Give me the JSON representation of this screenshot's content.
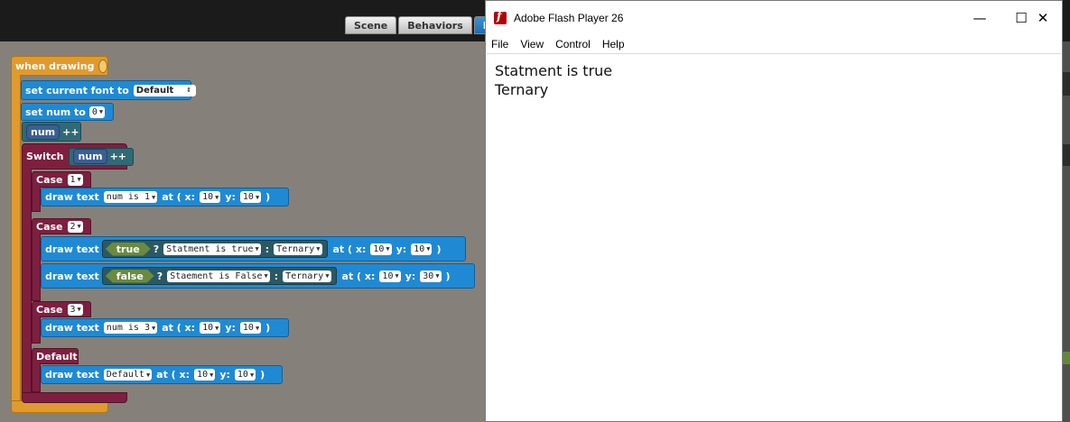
{
  "tabs": [
    "Scene",
    "Behaviors",
    "E"
  ],
  "blocks": {
    "event": "when drawing",
    "set_font": {
      "label": "set current font to",
      "value": "Default"
    },
    "set_num": {
      "label": "set num to",
      "value": "0"
    },
    "num_inc": {
      "var": "num",
      "op": "++"
    },
    "switch": {
      "label": "Switch",
      "var": "num",
      "op": "++"
    },
    "case1": {
      "label": "Case",
      "value": "1",
      "draw": {
        "label": "draw text",
        "text": "num is 1",
        "at": "at ( x:",
        "x": "10",
        "y_label": "y:",
        "y": "10",
        "close": ")"
      }
    },
    "case2": {
      "label": "Case",
      "value": "2",
      "draw1": {
        "label": "draw text",
        "cond": "true",
        "q": "?",
        "a": "Statment is true",
        "colon": ":",
        "b": "Ternary",
        "at": "at ( x:",
        "x": "10",
        "y_label": "y:",
        "y": "10",
        "close": ")"
      },
      "draw2": {
        "label": "draw text",
        "cond": "false",
        "q": "?",
        "a": "Staement is False",
        "colon": ":",
        "b": "Ternary",
        "at": "at ( x:",
        "x": "10",
        "y_label": "y:",
        "y": "30",
        "close": ")"
      }
    },
    "case3": {
      "label": "Case",
      "value": "3",
      "draw": {
        "label": "draw text",
        "text": "num is 3",
        "at": "at ( x:",
        "x": "10",
        "y_label": "y:",
        "y": "10",
        "close": ")"
      }
    },
    "default": {
      "label": "Default",
      "draw": {
        "label": "draw text",
        "text": "Default",
        "at": "at ( x:",
        "x": "10",
        "y_label": "y:",
        "y": "10",
        "close": ")"
      }
    }
  },
  "flash": {
    "title": "Adobe Flash Player 26",
    "controls": {
      "minimize": "—",
      "maximize": "☐",
      "close": "✕"
    },
    "menu": [
      "File",
      "View",
      "Control",
      "Help"
    ],
    "output": [
      "Statment is true",
      "Ternary"
    ]
  },
  "colors": {
    "orange": "#e09a2e",
    "blue": "#1f8ad3",
    "teal": "#2f6a76",
    "maroon": "#7e1f3f",
    "canvas": "#85817a"
  }
}
